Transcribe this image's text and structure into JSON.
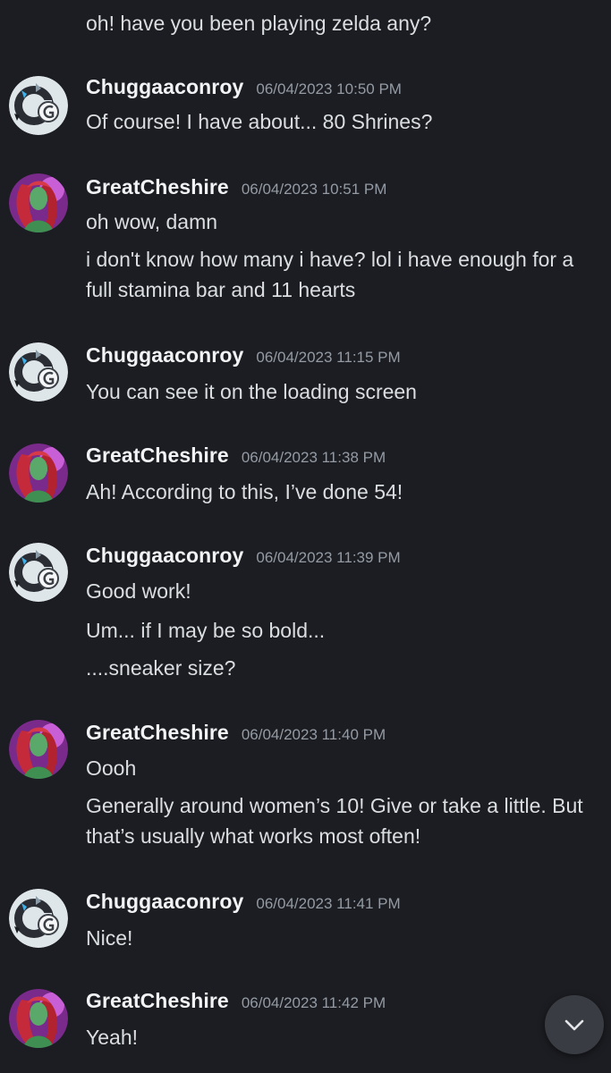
{
  "chat": {
    "top_fragment": "oh! have you been playing zelda any?",
    "messages": [
      {
        "author": "Chuggaaconroy",
        "timestamp": "06/04/2023 10:50 PM",
        "lines": [
          "Of course! I have about... 80 Shrines?"
        ]
      },
      {
        "author": "GreatCheshire",
        "timestamp": "06/04/2023 10:51 PM",
        "lines": [
          "oh wow, damn",
          "i don't know how many i have? lol i have enough for a full stamina bar and 11 hearts"
        ]
      },
      {
        "author": "Chuggaaconroy",
        "timestamp": "06/04/2023 11:15 PM",
        "lines": [
          "You can see it on the loading screen"
        ]
      },
      {
        "author": "GreatCheshire",
        "timestamp": "06/04/2023 11:38 PM",
        "lines": [
          "Ah! According to this, I’ve done 54!"
        ]
      },
      {
        "author": "Chuggaaconroy",
        "timestamp": "06/04/2023 11:39 PM",
        "lines": [
          "Good work!",
          "Um... if I may be so bold...",
          "....sneaker size?"
        ]
      },
      {
        "author": "GreatCheshire",
        "timestamp": "06/04/2023 11:40 PM",
        "lines": [
          "Oooh",
          "Generally around women’s 10! Give or take a little. But that’s usually what works most often!"
        ]
      },
      {
        "author": "Chuggaaconroy",
        "timestamp": "06/04/2023 11:41 PM",
        "lines": [
          "Nice!"
        ]
      },
      {
        "author": "GreatCheshire",
        "timestamp": "06/04/2023 11:42 PM",
        "lines": [
          "Yeah!"
        ]
      }
    ]
  },
  "avatars": {
    "chuggaaconroy_icon": "chuggaaconroy-avatar",
    "greatcheshire_icon": "greatcheshire-avatar"
  },
  "scroll_button": {
    "icon": "chevron-down-icon"
  },
  "colors": {
    "background": "#1c1d22",
    "text": "#dbdee1",
    "username": "#f2f3f5",
    "timestamp": "#949ba4",
    "scroll_button": "#3a3c43"
  }
}
